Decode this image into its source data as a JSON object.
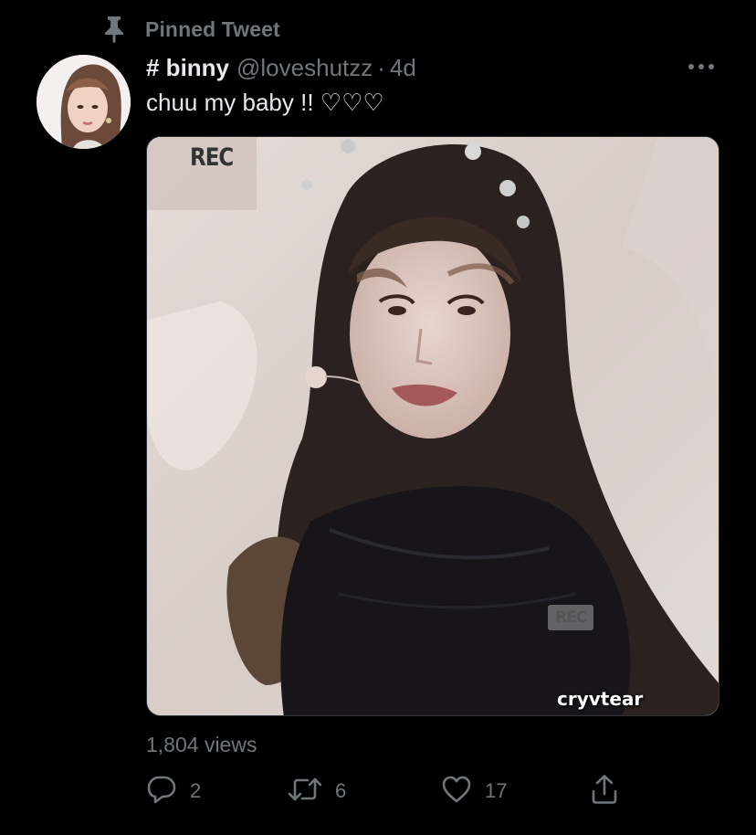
{
  "pinned": {
    "icon": "pin-icon",
    "label": "Pinned Tweet"
  },
  "tweet": {
    "author": {
      "display_name": "# binny",
      "handle": "@loveshutzz",
      "avatar": "avatar"
    },
    "separator": "·",
    "timestamp": "4d",
    "text": "chuu my baby !! ♡♡♡",
    "media": {
      "overlay_rec_top": "REC",
      "overlay_rec_bottom": "REC",
      "watermark": "cryvtear"
    },
    "views": "1,804 views",
    "actions": {
      "reply_count": "2",
      "retweet_count": "6",
      "like_count": "17"
    }
  },
  "colors": {
    "background": "#000000",
    "primary_text": "#e7e9ea",
    "secondary_text": "#71767b"
  }
}
